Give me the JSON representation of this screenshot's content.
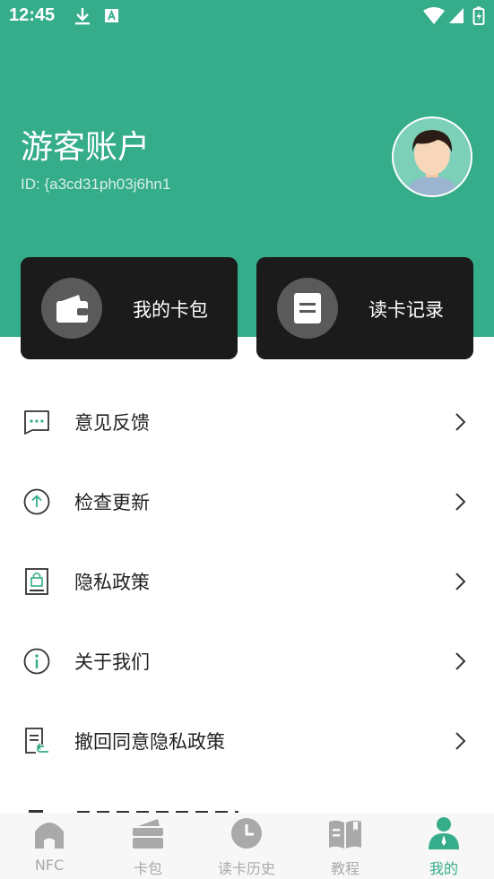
{
  "status_bar": {
    "time": "12:45"
  },
  "profile": {
    "name": "游客账户",
    "id": "ID: {a3cd31ph03j6hn1"
  },
  "cards": [
    {
      "label": "我的卡包",
      "icon": "wallet-icon"
    },
    {
      "label": "读卡记录",
      "icon": "document-icon"
    }
  ],
  "menu": [
    {
      "label": "意见反馈",
      "icon": "feedback-icon"
    },
    {
      "label": "检查更新",
      "icon": "update-icon"
    },
    {
      "label": "隐私政策",
      "icon": "privacy-icon"
    },
    {
      "label": "关于我们",
      "icon": "info-icon"
    },
    {
      "label": "撤回同意隐私政策",
      "icon": "revoke-icon"
    }
  ],
  "bottom_nav": [
    {
      "label": "NFC",
      "icon": "home-icon",
      "active": false
    },
    {
      "label": "卡包",
      "icon": "cardholder-icon",
      "active": false
    },
    {
      "label": "读卡历史",
      "icon": "clock-icon",
      "active": false
    },
    {
      "label": "教程",
      "icon": "book-icon",
      "active": false
    },
    {
      "label": "我的",
      "icon": "person-icon",
      "active": true
    }
  ],
  "colors": {
    "accent": "#35ad8a",
    "card_bg": "#1b1b1b",
    "inactive": "#a9a9a9"
  }
}
